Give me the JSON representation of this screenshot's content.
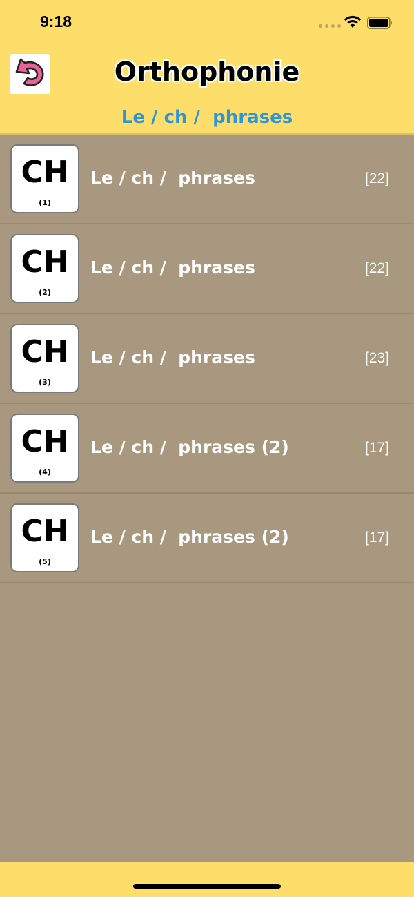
{
  "status_bar": {
    "time": "9:18",
    "icons": [
      "signal-dots-icon",
      "wifi-icon",
      "battery-icon"
    ]
  },
  "header": {
    "title": "Orthophonie",
    "subtitle": "Le / ch /  phrases",
    "back_icon": "undo-arrow-icon",
    "background_color": "#fede6a",
    "subtitle_color": "#2e94d6"
  },
  "list": {
    "background_color": "#a89880",
    "items": [
      {
        "tile_letters": "CH",
        "tile_number": "(1)",
        "label": "Le / ch /  phrases",
        "count": "[22]"
      },
      {
        "tile_letters": "CH",
        "tile_number": "(2)",
        "label": "Le / ch /  phrases",
        "count": "[22]"
      },
      {
        "tile_letters": "CH",
        "tile_number": "(3)",
        "label": "Le / ch /  phrases",
        "count": "[23]"
      },
      {
        "tile_letters": "CH",
        "tile_number": "(4)",
        "label": "Le / ch /  phrases (2)",
        "count": "[17]"
      },
      {
        "tile_letters": "CH",
        "tile_number": "(5)",
        "label": "Le / ch /  phrases (2)",
        "count": "[17]"
      }
    ]
  }
}
